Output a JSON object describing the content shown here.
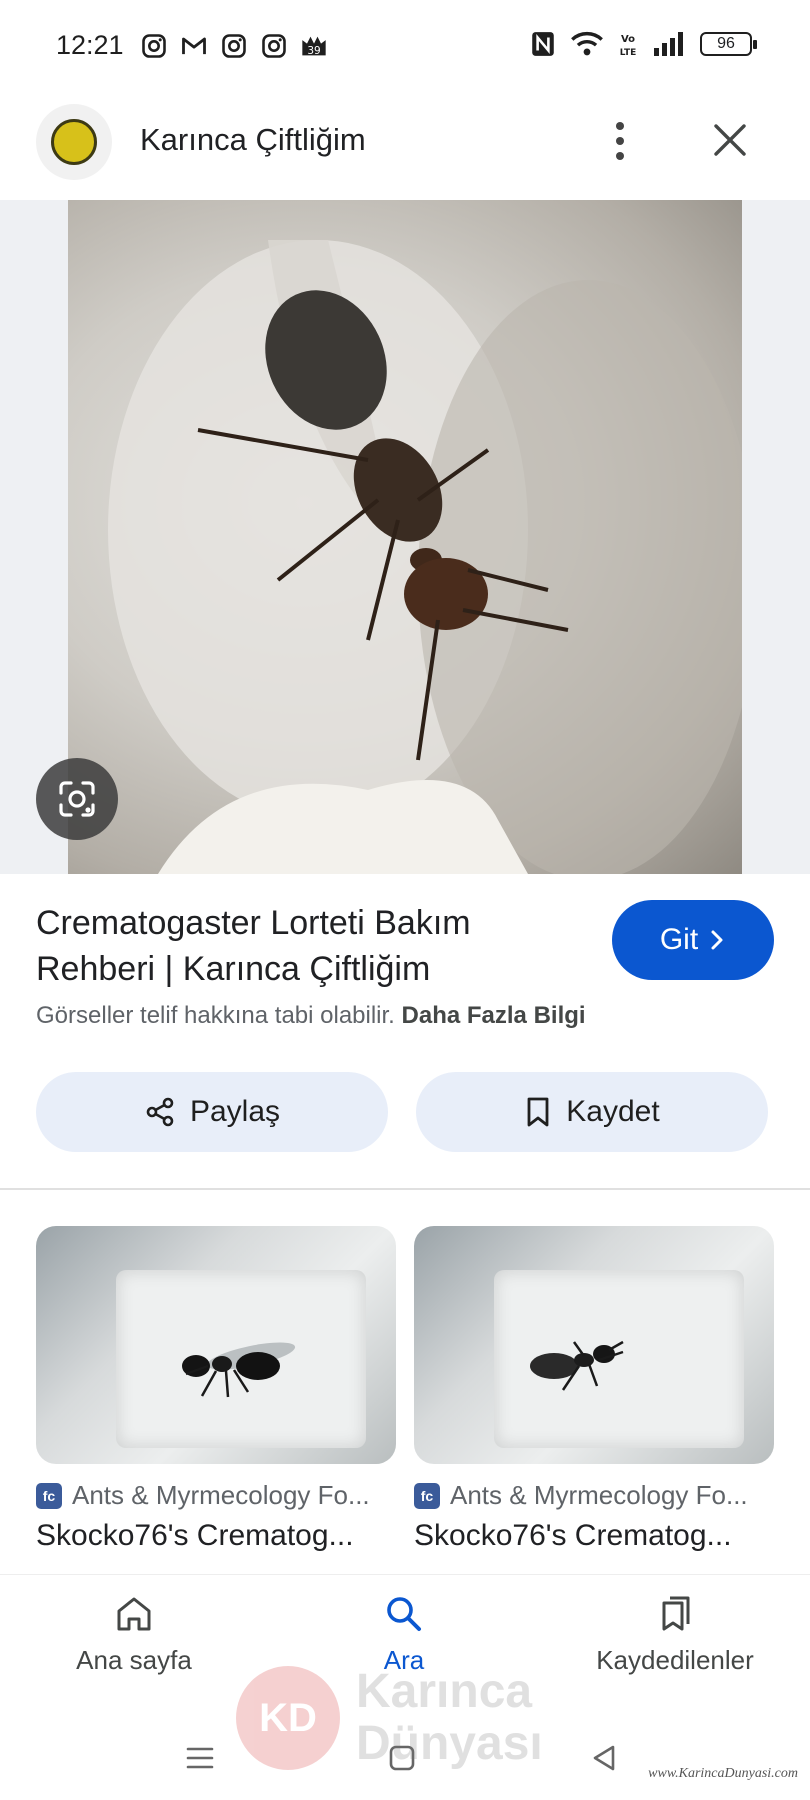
{
  "status_bar": {
    "time": "12:21",
    "notification_icons": [
      "instagram-icon",
      "gmail-icon",
      "instagram-icon",
      "instagram-icon",
      "badge-39-icon"
    ],
    "badge_count": "39",
    "system_icons": [
      "nfc-icon",
      "wifi-icon",
      "volte-icon",
      "signal-icon"
    ],
    "volte_label": "Vo LTE",
    "battery": "96"
  },
  "header": {
    "site_title": "Karınca Çiftliğim",
    "more_icon": "more-vert-icon",
    "close_icon": "close-icon"
  },
  "image": {
    "lens_icon": "google-lens-icon"
  },
  "result": {
    "title": "Crematogaster Lorteti Bakım Rehberi | Karınca Çiftliğim",
    "go_label": "Git",
    "copyright_text": "Görseller telif hakkına tabi olabilir.",
    "more_info_label": "Daha Fazla Bilgi"
  },
  "actions": {
    "share_label": "Paylaş",
    "save_label": "Kaydet"
  },
  "related": [
    {
      "source": "Ants & Myrmecology Fo...",
      "favicon_text": "fc",
      "title": "Skocko76's Crematog..."
    },
    {
      "source": "Ants & Myrmecology Fo...",
      "favicon_text": "fc",
      "title": "Skocko76's Crematog..."
    }
  ],
  "bottom_nav": {
    "home_label": "Ana sayfa",
    "search_label": "Ara",
    "saved_label": "Kaydedilenler"
  },
  "watermark": {
    "logo_text": "KD",
    "line1": "Karınca",
    "line2": "Dünyası",
    "url": "www.KarincaDunyasi.com"
  },
  "colors": {
    "accent": "#0b57d0",
    "chip_bg": "#e8eef9",
    "text_secondary": "#5f6368"
  }
}
